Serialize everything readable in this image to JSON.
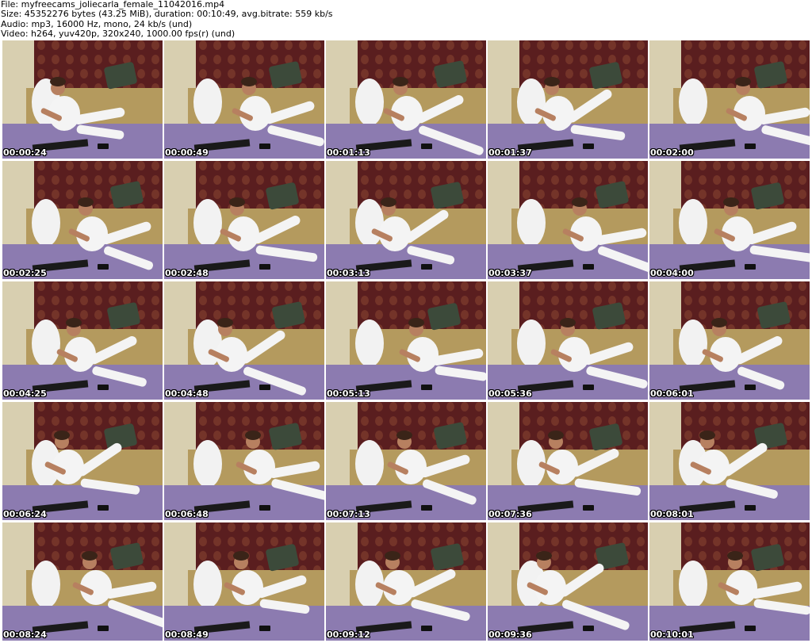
{
  "header": {
    "lines": [
      "File: myfreecams_joliecarla_female_11042016.mp4",
      "Size: 45352276 bytes (43.25 MiB), duration: 00:10:49, avg.bitrate: 559 kb/s",
      "Audio: mp3, 16000 Hz, mono, 24 kb/s (und)",
      "Video: h264, yuv420p, 320x240, 1000.00 fps(r) (und)"
    ]
  },
  "thumbnails": [
    {
      "timestamp": "00:00:24"
    },
    {
      "timestamp": "00:00:49"
    },
    {
      "timestamp": "00:01:13"
    },
    {
      "timestamp": "00:01:37"
    },
    {
      "timestamp": "00:02:00"
    },
    {
      "timestamp": "00:02:25"
    },
    {
      "timestamp": "00:02:48"
    },
    {
      "timestamp": "00:03:13"
    },
    {
      "timestamp": "00:03:37"
    },
    {
      "timestamp": "00:04:00"
    },
    {
      "timestamp": "00:04:25"
    },
    {
      "timestamp": "00:04:48"
    },
    {
      "timestamp": "00:05:13"
    },
    {
      "timestamp": "00:05:36"
    },
    {
      "timestamp": "00:06:01"
    },
    {
      "timestamp": "00:06:24"
    },
    {
      "timestamp": "00:06:48"
    },
    {
      "timestamp": "00:07:13"
    },
    {
      "timestamp": "00:07:36"
    },
    {
      "timestamp": "00:08:01"
    },
    {
      "timestamp": "00:08:24"
    },
    {
      "timestamp": "00:08:49"
    },
    {
      "timestamp": "00:09:12"
    },
    {
      "timestamp": "00:09:36"
    },
    {
      "timestamp": "00:10:01"
    }
  ],
  "colors": {
    "wallpaper": "#5a1e1f",
    "wallpaper_pattern": "#7a3a2c",
    "wall_light": "#d8cfb0",
    "sofa": "#b49a5e",
    "blanket": "#8c7bb0",
    "pillow_white": "#f2f2f2",
    "pillow_green": "#3c4a3a",
    "figure_skin": "#b78060",
    "figure_white": "#f4f4f4",
    "timestamp_text": "#ffffff"
  }
}
